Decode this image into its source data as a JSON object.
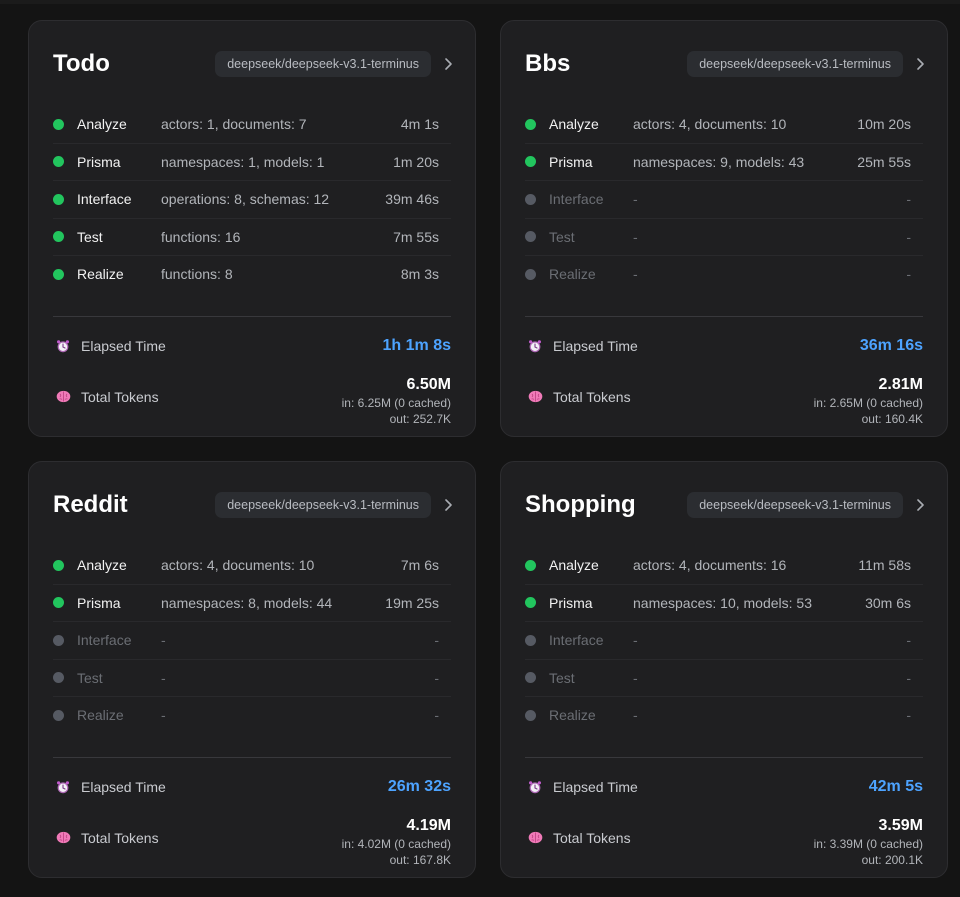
{
  "colors": {
    "done": "#22c55e",
    "pending": "#565a63",
    "accent": "#4da3ff"
  },
  "labels": {
    "elapsed": "Elapsed Time",
    "tokens": "Total Tokens"
  },
  "cards": [
    {
      "title": "Todo",
      "model": "deepseek/deepseek-v3.1-terminus",
      "phases": [
        {
          "name": "Analyze",
          "detail": "actors: 1, documents: 7",
          "time": "4m 1s",
          "status": "done"
        },
        {
          "name": "Prisma",
          "detail": "namespaces: 1, models: 1",
          "time": "1m 20s",
          "status": "done"
        },
        {
          "name": "Interface",
          "detail": "operations: 8, schemas: 12",
          "time": "39m 46s",
          "status": "done"
        },
        {
          "name": "Test",
          "detail": "functions: 16",
          "time": "7m 55s",
          "status": "done"
        },
        {
          "name": "Realize",
          "detail": "functions: 8",
          "time": "8m 3s",
          "status": "done"
        }
      ],
      "elapsed": "1h 1m 8s",
      "tokens": {
        "total": "6.50M",
        "input": "in: 6.25M (0 cached)",
        "output": "out: 252.7K"
      }
    },
    {
      "title": "Bbs",
      "model": "deepseek/deepseek-v3.1-terminus",
      "phases": [
        {
          "name": "Analyze",
          "detail": "actors: 4, documents: 10",
          "time": "10m 20s",
          "status": "done"
        },
        {
          "name": "Prisma",
          "detail": "namespaces: 9, models: 43",
          "time": "25m 55s",
          "status": "done"
        },
        {
          "name": "Interface",
          "detail": "-",
          "time": "-",
          "status": "pending"
        },
        {
          "name": "Test",
          "detail": "-",
          "time": "-",
          "status": "pending"
        },
        {
          "name": "Realize",
          "detail": "-",
          "time": "-",
          "status": "pending"
        }
      ],
      "elapsed": "36m 16s",
      "tokens": {
        "total": "2.81M",
        "input": "in: 2.65M (0 cached)",
        "output": "out: 160.4K"
      }
    },
    {
      "title": "Reddit",
      "model": "deepseek/deepseek-v3.1-terminus",
      "phases": [
        {
          "name": "Analyze",
          "detail": "actors: 4, documents: 10",
          "time": "7m 6s",
          "status": "done"
        },
        {
          "name": "Prisma",
          "detail": "namespaces: 8, models: 44",
          "time": "19m 25s",
          "status": "done"
        },
        {
          "name": "Interface",
          "detail": "-",
          "time": "-",
          "status": "pending"
        },
        {
          "name": "Test",
          "detail": "-",
          "time": "-",
          "status": "pending"
        },
        {
          "name": "Realize",
          "detail": "-",
          "time": "-",
          "status": "pending"
        }
      ],
      "elapsed": "26m 32s",
      "tokens": {
        "total": "4.19M",
        "input": "in: 4.02M (0 cached)",
        "output": "out: 167.8K"
      }
    },
    {
      "title": "Shopping",
      "model": "deepseek/deepseek-v3.1-terminus",
      "phases": [
        {
          "name": "Analyze",
          "detail": "actors: 4, documents: 16",
          "time": "11m 58s",
          "status": "done"
        },
        {
          "name": "Prisma",
          "detail": "namespaces: 10, models: 53",
          "time": "30m 6s",
          "status": "done"
        },
        {
          "name": "Interface",
          "detail": "-",
          "time": "-",
          "status": "pending"
        },
        {
          "name": "Test",
          "detail": "-",
          "time": "-",
          "status": "pending"
        },
        {
          "name": "Realize",
          "detail": "-",
          "time": "-",
          "status": "pending"
        }
      ],
      "elapsed": "42m 5s",
      "tokens": {
        "total": "3.59M",
        "input": "in: 3.39M (0 cached)",
        "output": "out: 200.1K"
      }
    }
  ]
}
